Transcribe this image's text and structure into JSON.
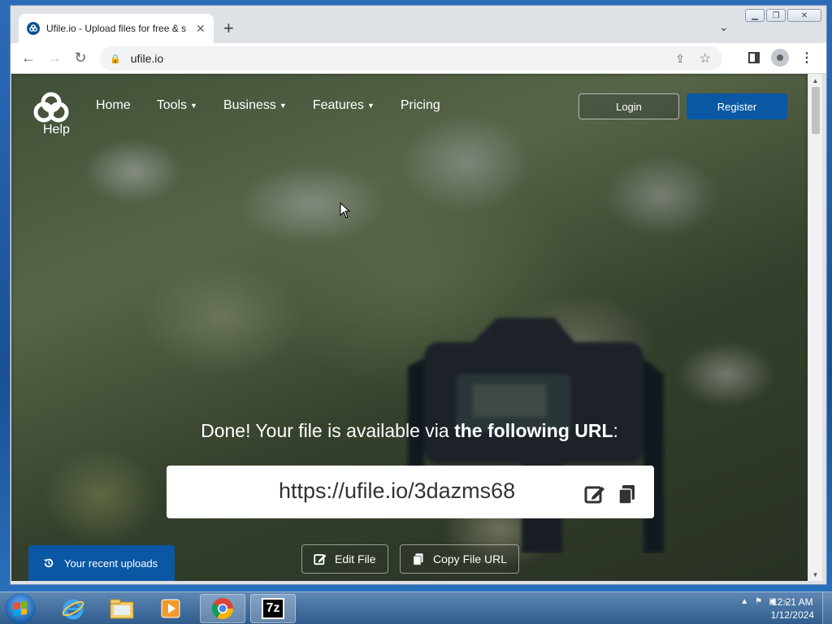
{
  "browser": {
    "tab_title": "Ufile.io - Upload files for free & s",
    "tab_close": "✕",
    "new_tab": "+",
    "url": "ufile.io"
  },
  "site": {
    "help_label": "Help",
    "nav": [
      {
        "label": "Home",
        "dropdown": false
      },
      {
        "label": "Tools",
        "dropdown": true
      },
      {
        "label": "Business",
        "dropdown": true
      },
      {
        "label": "Features",
        "dropdown": true
      },
      {
        "label": "Pricing",
        "dropdown": false
      }
    ],
    "login_label": "Login",
    "register_label": "Register",
    "accent_color": "#0a57a4"
  },
  "upload_result": {
    "message_prefix": "Done! Your file is available via ",
    "message_bold": "the following URL",
    "message_suffix": ":",
    "file_url": "https://ufile.io/3dazms68",
    "edit_label": "Edit File",
    "copy_label": "Copy File URL",
    "recent_label": "Your recent uploads"
  },
  "taskbar": {
    "time": "12:21 AM",
    "date": "1/12/2024",
    "apps": [
      "internet-explorer",
      "file-explorer",
      "media-player",
      "chrome",
      "7zip"
    ],
    "sevenzip_label": "7z"
  }
}
